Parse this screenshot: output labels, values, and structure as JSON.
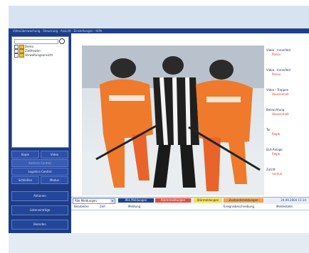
{
  "window": {
    "title": "Videoüberwachung · Steuerung · Ansicht · Einstellungen · Hilfe"
  },
  "tree": {
    "items": [
      "Demo",
      "Zieltheater",
      "Verwaltungsansicht"
    ]
  },
  "sidebar": {
    "buttons": [
      {
        "label": "Kopie"
      },
      {
        "label": "Video"
      },
      {
        "label": "Kamera Control"
      },
      {
        "label": "Logistics Control"
      },
      {
        "label": "Schließen"
      },
      {
        "label": "Modus"
      },
      {
        "label": "Aktionen"
      },
      {
        "label": "Listeneinträge"
      },
      {
        "label": "Beenden"
      }
    ]
  },
  "video": {
    "image_icon": "video-feed-icon"
  },
  "details": [
    {
      "label": "Video - Innenfeld",
      "value": "Passiv"
    },
    {
      "label": "Video - Innenfeld",
      "value": "Passiv"
    },
    {
      "label": "Video - Treppen",
      "value": "Hauseinheit"
    },
    {
      "label": "Beleuchtung",
      "value": "Hauseinheit"
    },
    {
      "label": "Tor",
      "value": "Regie"
    },
    {
      "label": "ELA-Anlage",
      "value": "Regie"
    },
    {
      "label": "Zutritt",
      "value": "normal"
    }
  ],
  "status": {
    "filter_value": "Alle Meldungen",
    "chips": [
      {
        "label": "Alle Meldungen",
        "bg": "#1f3f8c",
        "fg": "#ffffff"
      },
      {
        "label": "Alarmmeldungen",
        "bg": "#e74c3c",
        "fg": "#ffffff"
      },
      {
        "label": "Störmeldungen",
        "bg": "#f7e13a",
        "fg": "#333333"
      },
      {
        "label": "Zustandsmeldungen",
        "bg": "#f0a24a",
        "fg": "#333333"
      }
    ],
    "timestamp": "24.09.2004 15:14"
  },
  "table": {
    "headers": [
      "Bearbeiter",
      "Zeit",
      "Meldung",
      "Ereignisbeschreibung",
      "Meldestelle"
    ]
  },
  "colors": {
    "sidebar": "#1e3c86",
    "accent_red": "#d63a2b"
  }
}
